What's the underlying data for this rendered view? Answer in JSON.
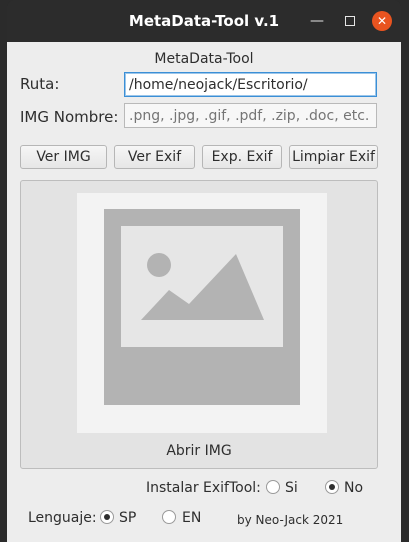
{
  "window": {
    "title": "MetaData-Tool v.1",
    "minimize_icon": "minimize-icon",
    "maximize_icon": "maximize-icon",
    "close_icon": "close-icon",
    "close_color": "#e95420"
  },
  "app": {
    "label": "MetaData-Tool"
  },
  "ruta": {
    "label": "Ruta:",
    "value": "/home/neojack/Escritorio/"
  },
  "img_nombre": {
    "label": "IMG Nombre:",
    "placeholder": ".png, .jpg, .gif, .pdf, .zip, .doc, etc."
  },
  "buttons": {
    "ver_img": "Ver IMG",
    "ver_exif": "Ver Exif",
    "exp_exif": "Exp. Exif",
    "limpiar_exif": "Limpiar Exif"
  },
  "image_panel": {
    "icon": "image-placeholder-icon",
    "caption": "Abrir IMG"
  },
  "instalar": {
    "label": "Instalar ExifTool:",
    "options": [
      "Si",
      "No"
    ],
    "selected": "No"
  },
  "lenguaje": {
    "label": "Lenguaje:",
    "options": [
      "SP",
      "EN"
    ],
    "selected": "SP"
  },
  "credit": "by Neo-Jack 2021"
}
